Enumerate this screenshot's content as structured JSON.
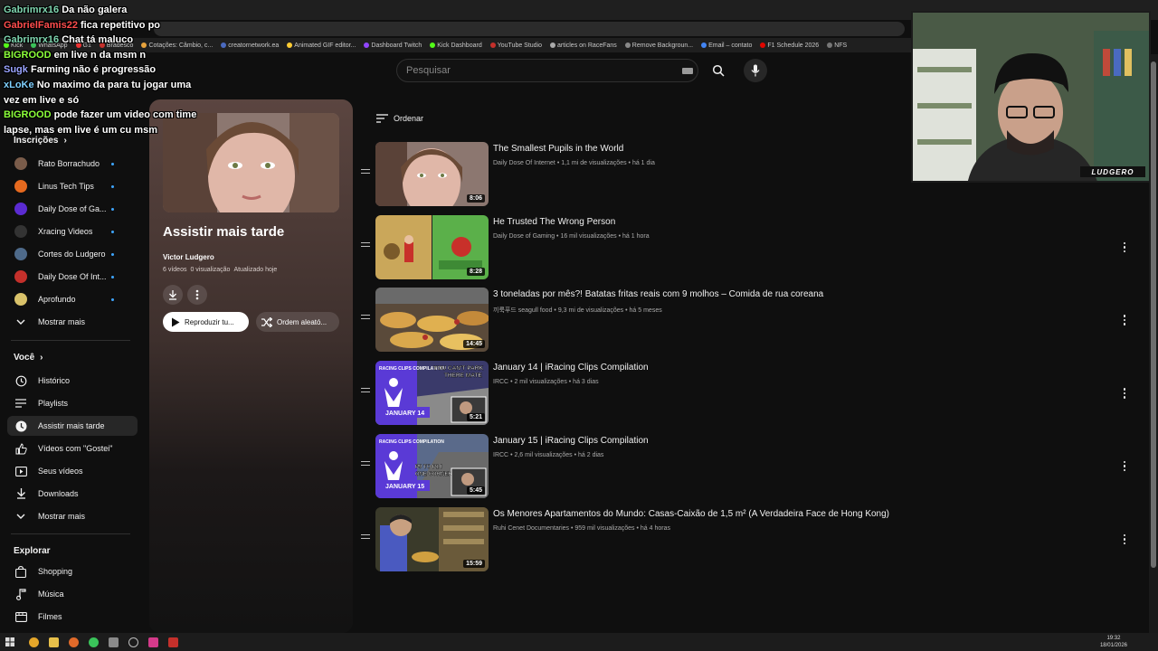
{
  "browser": {
    "bookmarks": [
      "Kick",
      "WhatsApp",
      "G1",
      "Bradesco",
      "Cotações: Câmbio, c...",
      "creatornetwork.ea",
      "Animated GIF editor...",
      "Dashboard Twitch",
      "Kick Dashboard",
      "YouTube Studio",
      "articles on RaceFans",
      "Remove Backgroun...",
      "Email – contato",
      "F1 Schedule 2026",
      "NFS"
    ]
  },
  "search": {
    "placeholder": "Pesquisar"
  },
  "sidebar": {
    "subscriptions_header": "Inscrições",
    "subscriptions": [
      {
        "label": "Rato Borrachudo",
        "color": "#7a5c4a"
      },
      {
        "label": "Linus Tech Tips",
        "color": "#e66a1f"
      },
      {
        "label": "Daily Dose of Ga...",
        "color": "#5b2bd1"
      },
      {
        "label": "Xracing Videos",
        "color": "#333333"
      },
      {
        "label": "Cortes do Ludgero",
        "color": "#4e6a8a"
      },
      {
        "label": "Daily Dose Of Int...",
        "color": "#c4302b"
      },
      {
        "label": "Aprofundo",
        "color": "#d9c26a"
      }
    ],
    "show_more_1": "Mostrar mais",
    "you_header": "Você",
    "you_items": [
      {
        "label": "Histórico",
        "icon": "history-icon"
      },
      {
        "label": "Playlists",
        "icon": "playlists-icon"
      },
      {
        "label": "Assistir mais tarde",
        "icon": "watch-later-icon",
        "active": true
      },
      {
        "label": "Vídeos com \"Gostei\"",
        "icon": "like-icon"
      },
      {
        "label": "Seus vídeos",
        "icon": "your-videos-icon"
      },
      {
        "label": "Downloads",
        "icon": "download-icon"
      }
    ],
    "show_more_2": "Mostrar mais",
    "explore_header": "Explorar",
    "explore_items": [
      {
        "label": "Shopping",
        "icon": "shopping-icon"
      },
      {
        "label": "Música",
        "icon": "music-icon"
      },
      {
        "label": "Filmes",
        "icon": "movies-icon"
      }
    ]
  },
  "playlist": {
    "title": "Assistir mais tarde",
    "owner": "Victor Ludgero",
    "video_count": "6 vídeos",
    "views": "0 visualização",
    "updated": "Atualizado hoje",
    "play_all": "Reproduzir tu...",
    "shuffle": "Ordem aleató..."
  },
  "sort_label": "Ordenar",
  "videos": [
    {
      "title": "The Smallest Pupils in the World",
      "channel": "Daily Dose Of Internet",
      "views": "1,1 mi de visualizações",
      "age": "há 1 dia",
      "duration": "8:06"
    },
    {
      "title": "He Trusted The Wrong Person",
      "channel": "Daily Dose of Gaming",
      "views": "16 mil visualizações",
      "age": "há 1 hora",
      "duration": "8:28"
    },
    {
      "title": "3 toneladas por mês?! Batatas fritas reais com 9 molhos – Comida de rua coreana",
      "channel": "끼룩푸드 seagull food",
      "views": "9,3 mi de visualizações",
      "age": "há 5 meses",
      "duration": "14:45"
    },
    {
      "title": "January 14 | iRacing Clips Compilation",
      "channel": "IRCC",
      "views": "2 mil visualizações",
      "age": "há 3 dias",
      "duration": "5:21"
    },
    {
      "title": "January 15 | iRacing Clips Compilation",
      "channel": "IRCC",
      "views": "2,6 mil visualizações",
      "age": "há 2 dias",
      "duration": "5:45"
    },
    {
      "title": "Os Menores Apartamentos do Mundo: Casas-Caixão de 1,5 m² (A Verdadeira Face de Hong Kong)",
      "channel": "Ruhi Cenet Documentaries",
      "views": "959 mil visualizações",
      "age": "há 4 horas",
      "duration": "15:59"
    }
  ],
  "thumb_texts": {
    "racing_clips": "RACING CLIPS COMPILATION",
    "jan14": "JANUARY 14",
    "jan14_caption": "YOU CAN'T PARK THERE MATE",
    "jan15": "JANUARY 15",
    "jan15_caption": "P9 TO P1 IN ONE CORNER"
  },
  "chat": [
    {
      "user": "Gabrimrx16",
      "color": "#7fd6b0",
      "text": "Da não galera"
    },
    {
      "user": "GabrielFamis22",
      "color": "#ff4d4d",
      "text": "fica repetitivo po"
    },
    {
      "user": "Gabrimrx16",
      "color": "#7fd6b0",
      "text": "Chat tá maluco"
    },
    {
      "user": "BIGROOD",
      "color": "#8cff3a",
      "text": "em live n da msm n"
    },
    {
      "user": "Sugk",
      "color": "#9aa3ff",
      "text": "Farming não é progressão"
    },
    {
      "user": "xLoKe",
      "color": "#7fd0ff",
      "text": "No maximo da para tu jogar uma vez em live e só"
    },
    {
      "user": "BIGROOD",
      "color": "#8cff3a",
      "text": "pode fazer um video com time lapse, mas em live é um cu msm"
    }
  ],
  "webcam": {
    "logo": "LUDGERO"
  },
  "taskbar": {
    "time": "19:32",
    "date": "18/01/2026"
  }
}
